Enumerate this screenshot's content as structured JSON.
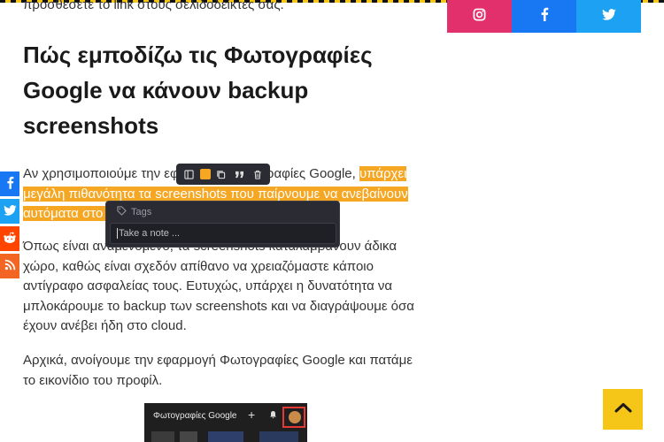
{
  "article": {
    "intro_line": "προσθέσετε το link στους σελιδοδείκτες σας.",
    "heading": "Πώς εμποδίζω τις Φωτογραφίες Google να κάνουν backup screenshots",
    "p1_before": "Αν χρησιμοποιούμε την εφαρμογή Φωτογραφίες Google, ",
    "p1_highlight": "υπάρχει μεγάλη πιθανότητα τα screenshots που παίρνουμε να ανεβαίνουν αυτόματα στο cloud.",
    "p2": "Όπως είναι αναμενόμενο, τα screenshots καταλαμβάνουν άδικα χώρο, καθώς είναι σχεδόν απίθανο να χρειαζόμαστε κάποιο αντίγραφο ασφαλείας τους. Ευτυχώς, υπάρχει η δυνατότητα να μπλοκάρουμε το backup των screenshots και να διαγράψουμε όσα έχουν ανέβει ήδη στο cloud.",
    "p3": "Αρχικά, ανοίγουμε την εφαρμογή Φωτογραφίες Google και πατάμε το εικονίδιο του προφίλ."
  },
  "embedded_screenshot": {
    "title": "Φωτογραφίες Google",
    "plus_icon": "plus-icon",
    "bell_icon": "bell-icon",
    "avatar_icon": "avatar-icon"
  },
  "social_top": [
    {
      "icon": "instagram-icon",
      "color": "#e1306c"
    },
    {
      "icon": "facebook-icon",
      "color": "#1877f2"
    },
    {
      "icon": "twitter-icon",
      "color": "#1da1f2"
    }
  ],
  "share_rail": [
    {
      "icon": "facebook-icon",
      "color": "#1877f2"
    },
    {
      "icon": "twitter-icon",
      "color": "#1da1f2"
    },
    {
      "icon": "reddit-icon",
      "color": "#ff4500"
    },
    {
      "icon": "rss-icon",
      "color": "#f26522"
    }
  ],
  "highlight_toolbar": {
    "icons": [
      "sidebar-icon",
      "color-swatch",
      "copy-icon",
      "quote-icon",
      "trash-icon"
    ],
    "highlight_color": "#f5a623"
  },
  "note_popup": {
    "tags_label": "Tags",
    "note_placeholder": "Take a note ..."
  },
  "back_to_top": {
    "icon": "chevron-up-icon",
    "color": "#f5c518"
  }
}
